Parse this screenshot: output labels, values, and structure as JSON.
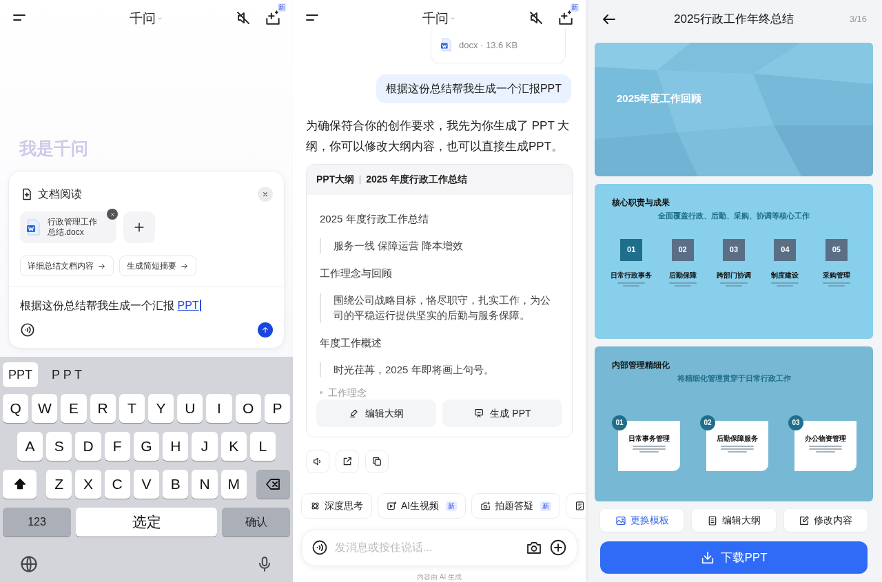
{
  "left_screen": {
    "header": {
      "title": "千问",
      "badge": "新"
    },
    "greeting": "我是千问",
    "doc_card": {
      "title": "文档阅读",
      "file_name": "行政管理工作总结.docx",
      "suggestions": [
        "详细总结文档内容",
        "生成简短摘要"
      ],
      "input_text": "根据这份总结帮我生成一个汇报 ",
      "composing_text": "PPT"
    },
    "keyboard": {
      "candidates": [
        {
          "label": "PPT",
          "selected": true
        },
        {
          "label": "P P T",
          "selected": false
        }
      ],
      "rows": [
        [
          "Q",
          "W",
          "E",
          "R",
          "T",
          "Y",
          "U",
          "I",
          "O",
          "P"
        ],
        [
          "A",
          "S",
          "D",
          "F",
          "G",
          "H",
          "J",
          "K",
          "L"
        ],
        [
          "Z",
          "X",
          "C",
          "V",
          "B",
          "N",
          "M"
        ]
      ],
      "shift_on": true,
      "numbers_key": "123",
      "space_key": "选定",
      "confirm_key": "确认"
    }
  },
  "middle_screen": {
    "header": {
      "title": "千问",
      "badge": "新"
    },
    "attachment": {
      "meta": "docx · 13.6 KB"
    },
    "user_message": "根据这份总结帮我生成一个汇报PPT",
    "reply": "为确保符合你的创作要求，我先为你生成了 PPT 大纲，你可以修改大纲内容，也可以直接生成PPT。",
    "outline": {
      "label": "PPT大纲",
      "title": "2025 年度行政工作总结",
      "items": [
        {
          "kind": "heading",
          "text": "2025 年度行政工作总结"
        },
        {
          "kind": "quote",
          "text": "服务一线 保障运营 降本增效"
        },
        {
          "kind": "heading",
          "text": "工作理念与回顾"
        },
        {
          "kind": "quote",
          "text": "围绕公司战略目标，恪尽职守，扎实工作，为公司的平稳运行提供坚实的后勤与服务保障。"
        },
        {
          "kind": "heading",
          "text": "年度工作概述"
        },
        {
          "kind": "quote",
          "text": "时光荏苒，2025 年即将画上句号。"
        },
        {
          "kind": "bullet",
          "text": "工作理念"
        }
      ],
      "actions": [
        "编辑大纲",
        "生成 PPT"
      ]
    },
    "tools": [
      {
        "label": "深度思考"
      },
      {
        "label": "AI生视频",
        "badge": "新"
      },
      {
        "label": "拍题答疑",
        "badge": "新"
      }
    ],
    "input": {
      "placeholder": "发消息或按住说话..."
    },
    "disclaimer": "内容由 AI 生成"
  },
  "right_screen": {
    "title": "2025行政工作年终总结",
    "page": "3/16",
    "slides": [
      {
        "kind": "cover",
        "title": "2025年度工作回顾"
      },
      {
        "kind": "grid",
        "title": "核心职责与成果",
        "subtitle": "全面覆盖行政、后勤、采购、协调等核心工作",
        "items": [
          {
            "number": "01",
            "title": "日常行政事务",
            "color": "#1f6e8c"
          },
          {
            "number": "02",
            "title": "后勤保障",
            "color": "#5a6f86"
          },
          {
            "number": "03",
            "title": "跨部门协调",
            "color": "#5a6f86"
          },
          {
            "number": "04",
            "title": "制度建设",
            "color": "#5a6f86"
          },
          {
            "number": "05",
            "title": "采购管理",
            "color": "#5a6f86"
          }
        ]
      },
      {
        "kind": "cards",
        "title": "内部管理精细化",
        "subtitle": "将精细化管理贯穿于日常行政工作",
        "items": [
          {
            "number": "01",
            "title": "日常事务管理"
          },
          {
            "number": "02",
            "title": "后勤保障服务"
          },
          {
            "number": "03",
            "title": "办公物资管理"
          }
        ]
      }
    ],
    "actions": [
      {
        "label": "更换模板",
        "selected": true
      },
      {
        "label": "编辑大纲",
        "selected": false
      },
      {
        "label": "修改内容",
        "selected": false
      }
    ],
    "download": "下载PPT"
  }
}
